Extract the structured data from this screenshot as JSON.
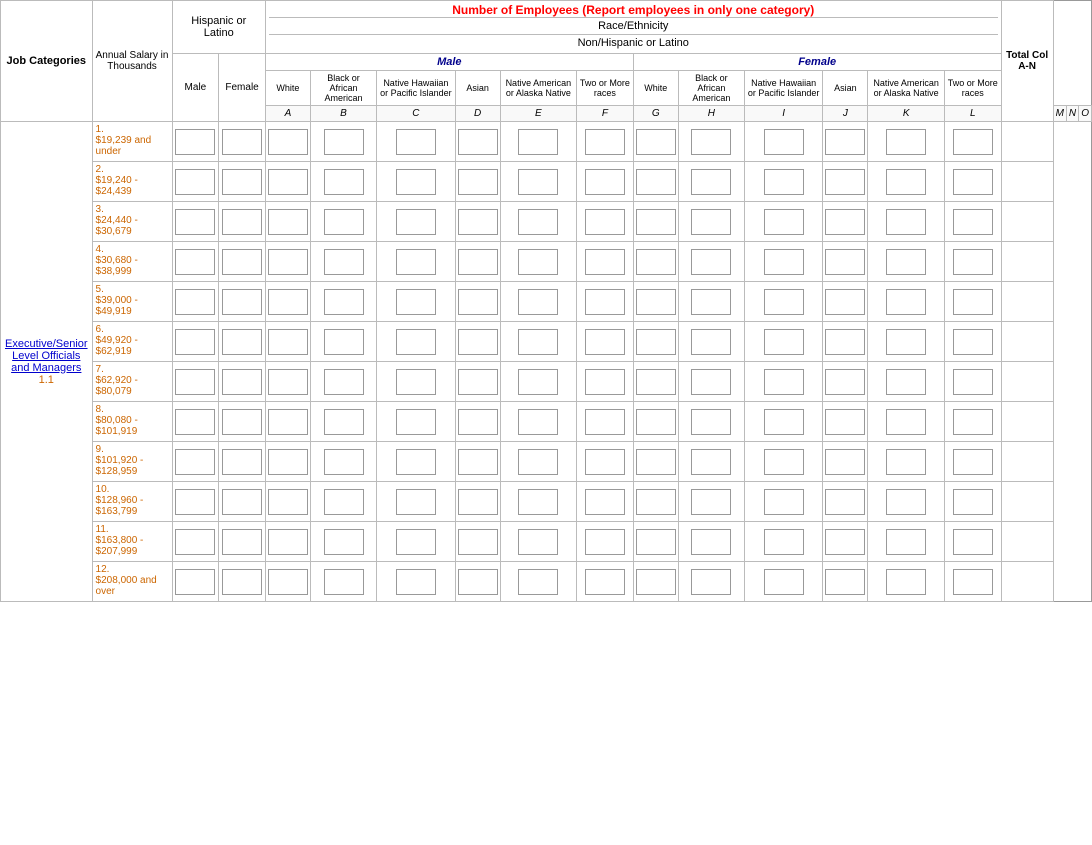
{
  "title": "Number of Employees (Report employees in only one category)",
  "race_ethnicity": "Race/Ethnicity",
  "hispanic_label": "Hispanic or Latino",
  "non_hispanic_label": "Non/Hispanic or Latino",
  "male_label": "Male",
  "female_label": "Female",
  "total_col_label": "Total Col A-N",
  "annual_salary_label": "Annual Salary in Thousands",
  "job_categories_label": "Job Categories",
  "job_category": {
    "name": "Executive/Senior Level Officials and Managers",
    "number": "1.1"
  },
  "columns": {
    "hispanic_male": "A",
    "hispanic_female": "B",
    "white_male": "C",
    "black_male": "D",
    "native_hawaiian_male": "E",
    "asian_male": "F",
    "native_american_male": "G",
    "two_more_male": "H",
    "white_female": "I",
    "black_female": "J",
    "native_hawaiian_female": "K",
    "asian_female": "L",
    "native_american_female": "M",
    "two_more_female": "N",
    "total": "O"
  },
  "col_headers": {
    "male_col_a": "A",
    "male_col_b": "B",
    "male_col_c": "C",
    "male_col_d": "D",
    "male_col_e": "E",
    "male_col_f": "F",
    "male_col_g": "G",
    "male_col_h": "H",
    "female_col_i": "I",
    "female_col_j": "J",
    "female_col_k": "K",
    "female_col_l": "L",
    "female_col_m": "M",
    "female_col_n": "N",
    "total_col_o": "O"
  },
  "sub_col_headers": {
    "white": "White",
    "black_african_american": "Black or African American",
    "native_hawaiian_pacific": "Native Hawaiian or Pacific Islander",
    "asian": "Asian",
    "native_american_alaska": "Native American or Alaska Native",
    "two_or_more": "Two or More races"
  },
  "salary_rows": [
    {
      "num": "1.",
      "range": "$19,239 and under"
    },
    {
      "num": "2.",
      "range": "$19,240 - $24,439"
    },
    {
      "num": "3.",
      "range": "$24,440 - $30,679"
    },
    {
      "num": "4.",
      "range": "$30,680 - $38,999"
    },
    {
      "num": "5.",
      "range": "$39,000 - $49,919"
    },
    {
      "num": "6.",
      "range": "$49,920 - $62,919"
    },
    {
      "num": "7.",
      "range": "$62,920 - $80,079"
    },
    {
      "num": "8.",
      "range": "$80,080 - $101,919"
    },
    {
      "num": "9.",
      "range": "$101,920 - $128,959"
    },
    {
      "num": "10.",
      "range": "$128,960 - $163,799"
    },
    {
      "num": "11.",
      "range": "$163,800 - $207,999"
    },
    {
      "num": "12.",
      "range": "$208,000 and over"
    }
  ]
}
